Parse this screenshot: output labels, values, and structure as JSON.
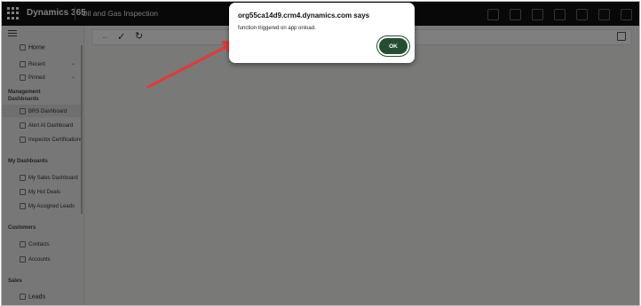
{
  "topbar": {
    "product_name": "Dynamics 365",
    "app_name": "Oil and Gas Inspection"
  },
  "sidebar": {
    "items": [
      {
        "label": "Home",
        "kind": "strong"
      },
      {
        "label": "Recent",
        "kind": "item",
        "expandable": true
      },
      {
        "label": "Pinned",
        "kind": "item",
        "expandable": true
      },
      {
        "label": "Management Dashboards",
        "kind": "group"
      },
      {
        "label": "BRS Dashboard",
        "kind": "item",
        "selected": true
      },
      {
        "label": "Alert AI Dashboard",
        "kind": "item"
      },
      {
        "label": "Inspector Certifications",
        "kind": "item"
      },
      {
        "label": "My Dashboards",
        "kind": "group"
      },
      {
        "label": "My Sales Dashboard",
        "kind": "item"
      },
      {
        "label": "My Hot Deals",
        "kind": "item"
      },
      {
        "label": "My Assigned Leads",
        "kind": "item"
      },
      {
        "label": "Customers",
        "kind": "group"
      },
      {
        "label": "Contacts",
        "kind": "item"
      },
      {
        "label": "Accounts",
        "kind": "item"
      },
      {
        "label": "Sales",
        "kind": "group"
      },
      {
        "label": "Leads",
        "kind": "strong"
      }
    ]
  },
  "dialog": {
    "title": "org55ca14d9.crm4.dynamics.com says",
    "message": "function triggered on app onload.",
    "ok_label": "OK"
  },
  "colors": {
    "topbar": "#111111",
    "ok_button": "#254d32",
    "annotation_arrow": "#e03a3a",
    "overlay": "rgba(0,0,0,0.5)"
  }
}
